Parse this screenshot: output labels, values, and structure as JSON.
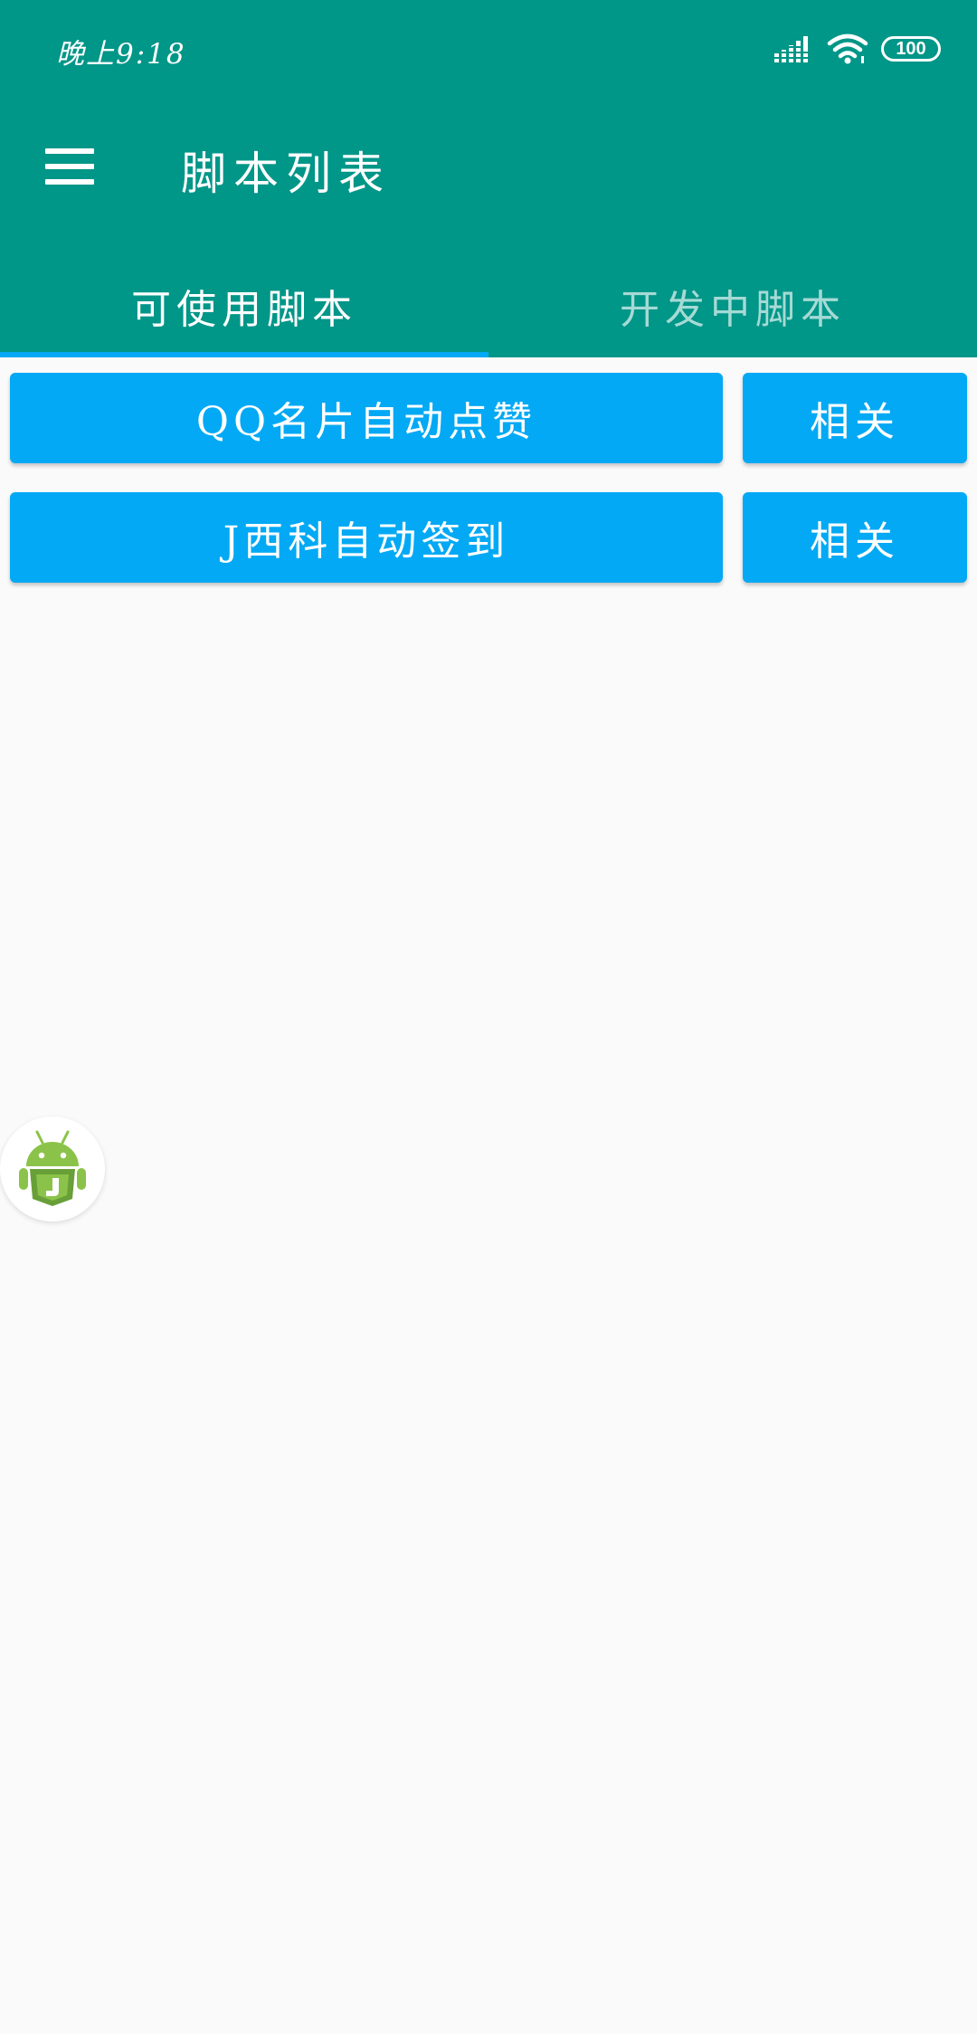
{
  "status_bar": {
    "time": "晚上9:18",
    "battery": "100"
  },
  "toolbar": {
    "title": "脚本列表",
    "menu_icon": "hamburger-menu-icon"
  },
  "tabs": [
    {
      "label": "可使用脚本",
      "selected": true
    },
    {
      "label": "开发中脚本",
      "selected": false
    }
  ],
  "scripts": [
    {
      "name": "QQ名片自动点赞",
      "related_label": "相关"
    },
    {
      "name": "J西科自动签到",
      "related_label": "相关"
    }
  ],
  "floating_button": {
    "icon": "android-js-icon"
  },
  "colors": {
    "primary": "#009688",
    "accent": "#03a9f4",
    "background": "#fafafa"
  }
}
